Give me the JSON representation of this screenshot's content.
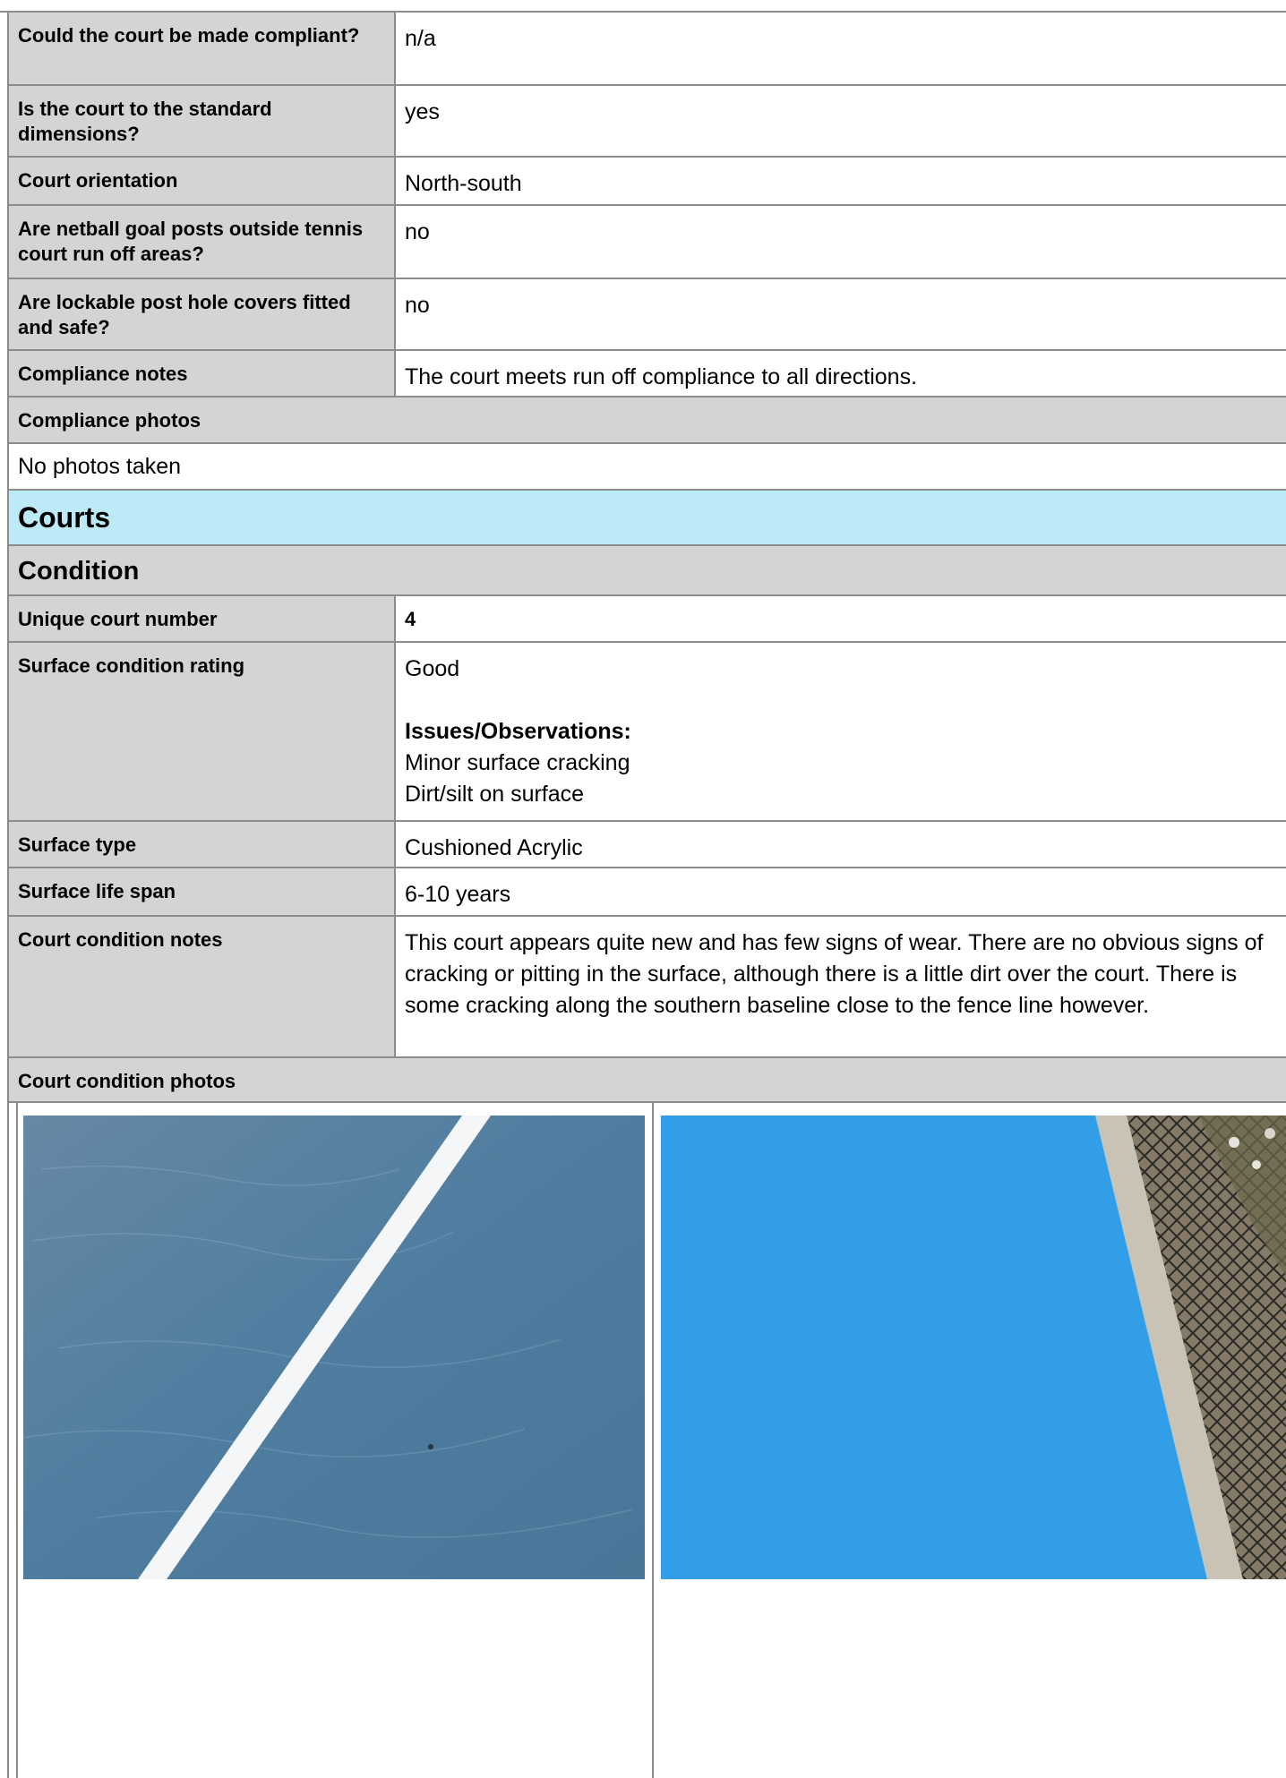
{
  "compliance": {
    "rows": [
      {
        "label": "Could the court be made compliant?",
        "value": "n/a"
      },
      {
        "label": "Is the court to the standard dimensions?",
        "value": "yes"
      },
      {
        "label": "Court orientation",
        "value": "North-south"
      },
      {
        "label": "Are netball goal posts outside tennis court run off areas?",
        "value": "no"
      },
      {
        "label": "Are lockable post hole covers fitted and safe?",
        "value": "no"
      },
      {
        "label": "Compliance notes",
        "value": "The court meets run off compliance to all directions."
      }
    ],
    "photos_label": "Compliance photos",
    "photos_value": "No photos taken"
  },
  "courts": {
    "title": "Courts",
    "condition_title": "Condition",
    "rows": [
      {
        "label": "Unique court number",
        "value": "4"
      },
      {
        "label": "Surface condition rating",
        "value": "Good",
        "issues_heading": "Issues/Observations:",
        "issues": [
          "Minor surface cracking",
          "Dirt/silt on surface"
        ]
      },
      {
        "label": "Surface type",
        "value": "Cushioned Acrylic"
      },
      {
        "label": "Surface life span",
        "value": "6-10 years"
      },
      {
        "label": "Court condition notes",
        "value": "This court appears quite new and has few signs of wear. There are no obvious signs of cracking or pitting in the surface, although there is a little dirt over the court. There is some cracking along the southern baseline close to the fence line however."
      }
    ],
    "photos_label": "Court condition photos"
  },
  "colors": {
    "label_bg": "#d4d4d4",
    "section_bg": "#bcebf7",
    "border": "#8c8c8c",
    "court_dark_blue": "#4e7da0",
    "court_bright_blue": "#33a2ea"
  }
}
